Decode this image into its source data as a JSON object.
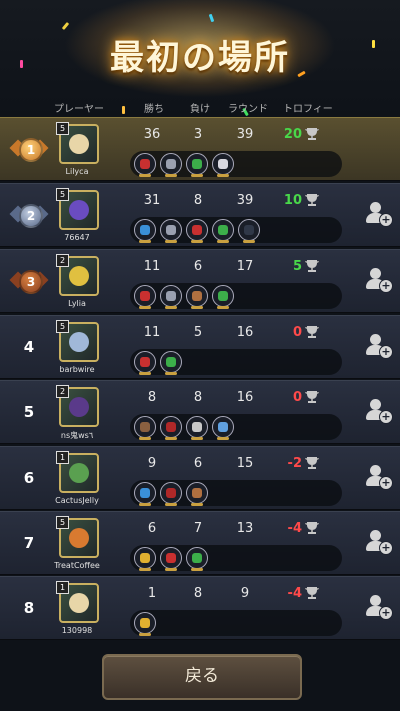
{
  "title": "最初の場所",
  "headers": {
    "player": "プレーヤー",
    "wins": "勝ち",
    "losses": "負け",
    "rounds": "ラウンド",
    "trophy": "トロフィー"
  },
  "colors": {
    "positive": "#49d84a",
    "negative": "#ff4a4a",
    "gold": "#c9b060"
  },
  "players": [
    {
      "rank": "1",
      "name": "Lilyca",
      "level": "5",
      "wins": "36",
      "losses": "3",
      "rounds": "39",
      "trophy": "20",
      "trophy_sign": "positive",
      "avatar_color": "#e8d6a8",
      "pets": [
        "red-claw-icon",
        "shield-icon",
        "green-leaf-icon",
        "spirit-icon"
      ],
      "show_add": false
    },
    {
      "rank": "2",
      "name": "76647",
      "level": "5",
      "wins": "31",
      "losses": "8",
      "rounds": "39",
      "trophy": "10",
      "trophy_sign": "positive",
      "avatar_color": "#6a4cc0",
      "pets": [
        "blue-fish-icon",
        "shield-icon",
        "red-claw-icon",
        "green-leaf-icon",
        "dark-orb-icon"
      ],
      "show_add": true
    },
    {
      "rank": "3",
      "name": "Lylia",
      "level": "2",
      "wins": "11",
      "losses": "6",
      "rounds": "17",
      "trophy": "5",
      "trophy_sign": "positive",
      "avatar_color": "#e0c040",
      "pets": [
        "red-claw-icon",
        "shield-icon",
        "paw-icon",
        "green-leaf-icon"
      ],
      "show_add": true
    },
    {
      "rank": "4",
      "name": "barbwire",
      "level": "5",
      "wins": "11",
      "losses": "5",
      "rounds": "16",
      "trophy": "0",
      "trophy_sign": "negative",
      "avatar_color": "#a0b8d8",
      "pets": [
        "red-claw-icon",
        "green-leaf-icon"
      ],
      "show_add": true
    },
    {
      "rank": "5",
      "name": "ns鬼ws٦",
      "level": "2",
      "wins": "8",
      "losses": "8",
      "rounds": "16",
      "trophy": "0",
      "trophy_sign": "negative",
      "avatar_color": "#5a3a8a",
      "pets": [
        "monk-icon",
        "red-beast-icon",
        "skull-icon",
        "wing-icon"
      ],
      "show_add": true
    },
    {
      "rank": "6",
      "name": "CactusJelly",
      "level": "1",
      "wins": "9",
      "losses": "6",
      "rounds": "15",
      "trophy": "-2",
      "trophy_sign": "negative",
      "avatar_color": "#5aa050",
      "pets": [
        "blue-fish-icon",
        "red-beast-icon",
        "paw-icon"
      ],
      "show_add": true
    },
    {
      "rank": "7",
      "name": "TreatCoffee",
      "level": "5",
      "wins": "6",
      "losses": "7",
      "rounds": "13",
      "trophy": "-4",
      "trophy_sign": "negative",
      "avatar_color": "#d87a30",
      "pets": [
        "gold-cross-icon",
        "red-claw-icon",
        "green-leaf-icon"
      ],
      "show_add": true
    },
    {
      "rank": "8",
      "name": "130998",
      "level": "1",
      "wins": "1",
      "losses": "8",
      "rounds": "9",
      "trophy": "-4",
      "trophy_sign": "negative",
      "avatar_color": "#e8d6a8",
      "pets": [
        "gold-cross-icon"
      ],
      "show_add": true
    }
  ],
  "pet_colors": {
    "red-claw-icon": "#c83030",
    "shield-icon": "#9aa0b0",
    "green-leaf-icon": "#3cae4a",
    "spirit-icon": "#d8d8e0",
    "blue-fish-icon": "#3a90d8",
    "dark-orb-icon": "#303848",
    "paw-icon": "#b07040",
    "monk-icon": "#8a6040",
    "red-beast-icon": "#b02828",
    "skull-icon": "#c8c8c8",
    "wing-icon": "#60a0e0",
    "gold-cross-icon": "#e0b030"
  },
  "back_button": "戻る"
}
